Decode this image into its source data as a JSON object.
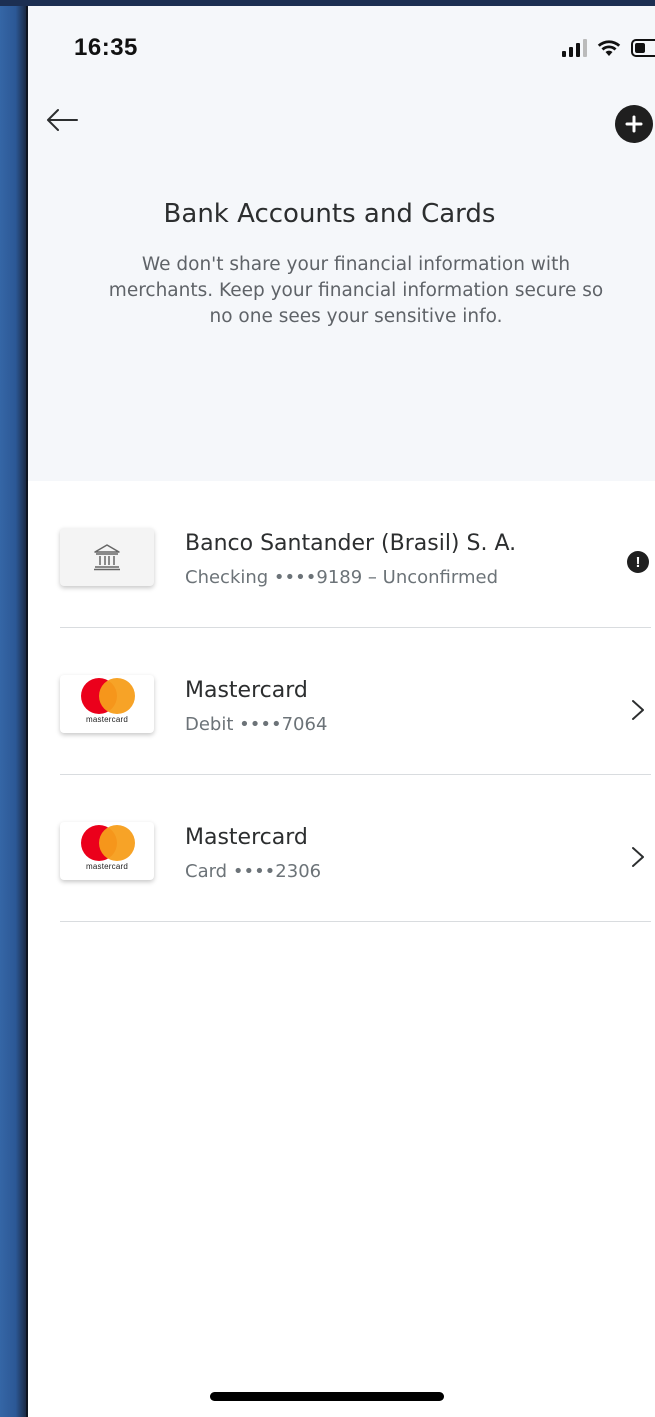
{
  "status_bar": {
    "time": "16:35",
    "battery_level": 0.45,
    "icons": [
      "signal-icon",
      "wifi-icon",
      "battery-icon"
    ]
  },
  "header": {
    "back_icon": "arrow-left-icon",
    "add_icon": "plus-circle-icon",
    "title": "Bank Accounts and Cards",
    "subtitle": "We don't share your financial information with merchants. Keep your financial information secure so no one sees your sensitive info."
  },
  "accounts": [
    {
      "kind": "bank",
      "icon": "bank-icon",
      "title": "Banco Santander (Brasil) S. A.",
      "subtitle": "Checking ••••9189 – Unconfirmed",
      "trailing": "alert-icon"
    },
    {
      "kind": "card",
      "icon": "mastercard-logo",
      "brand_text": "mastercard",
      "title": "Mastercard",
      "subtitle": "Debit ••••7064",
      "trailing": "chevron-right-icon"
    },
    {
      "kind": "card",
      "icon": "mastercard-logo",
      "brand_text": "mastercard",
      "title": "Mastercard",
      "subtitle": "Card ••••2306",
      "trailing": "chevron-right-icon"
    }
  ],
  "colors": {
    "header_bg": "#f5f7fa",
    "text_primary": "#2c2e2f",
    "text_secondary": "#6c7378",
    "mastercard_red": "#eb001b",
    "mastercard_orange": "#f79e1b"
  }
}
